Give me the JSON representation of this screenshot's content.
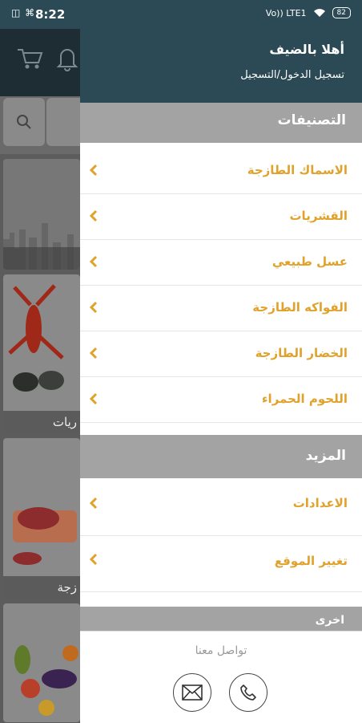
{
  "status_bar": {
    "time": "8:22",
    "left_icons": "◫ ⌘",
    "network": "Vo)) LTE1",
    "battery": "82"
  },
  "background": {
    "tiles": [
      {
        "caption": ""
      },
      {
        "caption": "ريات"
      },
      {
        "caption": "زجة"
      },
      {
        "caption": ""
      }
    ]
  },
  "drawer": {
    "greeting": "أهلا بالضيف",
    "login_link": "تسجيل الدخول/التسجيل",
    "categories_title": "التصنيفات",
    "categories": [
      {
        "label": "الاسماك الطازجة"
      },
      {
        "label": "القشريات"
      },
      {
        "label": "عسل طبيعي"
      },
      {
        "label": "الفواكه الطازجة"
      },
      {
        "label": "الخضار الطازجة"
      },
      {
        "label": "اللحوم الحمراء"
      }
    ],
    "more_title": "المزيد",
    "more_items": [
      {
        "label": "الاعدادات"
      },
      {
        "label": "تغيير الموقع"
      }
    ],
    "other_title": "اخرى",
    "contact_title": "تواصل معنا"
  },
  "colors": {
    "header": "#2c4a55",
    "accent": "#e1a22b",
    "section": "#a3a3a3"
  }
}
